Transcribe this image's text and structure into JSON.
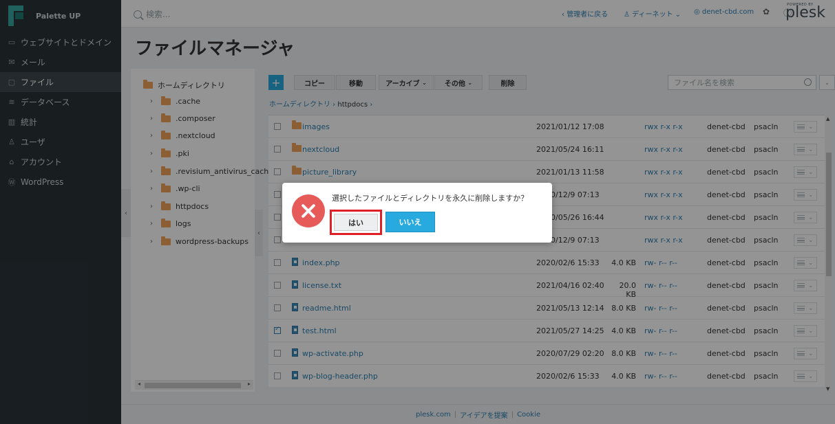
{
  "brand": {
    "name": "Palette UP"
  },
  "sidebar": {
    "items": [
      {
        "label": "ウェブサイトとドメイン",
        "icon": "monitor-icon",
        "active": false
      },
      {
        "label": "メール",
        "icon": "mail-icon",
        "active": false
      },
      {
        "label": "ファイル",
        "icon": "folder-icon",
        "active": true
      },
      {
        "label": "データベース",
        "icon": "database-icon",
        "active": false
      },
      {
        "label": "統計",
        "icon": "chart-icon",
        "active": false
      },
      {
        "label": "ユーザ",
        "icon": "user-icon",
        "active": false
      },
      {
        "label": "アカウント",
        "icon": "account-icon",
        "active": false
      },
      {
        "label": "WordPress",
        "icon": "wordpress-icon",
        "active": false
      }
    ]
  },
  "header": {
    "search_placeholder": "検索...",
    "back_admin": "管理者に戻る",
    "account": "ディーネット",
    "domain": "denet-cbd.com",
    "powered_by": "POWERED BY",
    "plesk": "plesk"
  },
  "page": {
    "title": "ファイルマネージャ"
  },
  "tree": {
    "root": "ホームディレクトリ",
    "items": [
      ".cache",
      ".composer",
      ".nextcloud",
      ".pki",
      ".revisium_antivirus_cach",
      ".wp-cli",
      "httpdocs",
      "logs",
      "wordpress-backups"
    ]
  },
  "toolbar": {
    "add": "+",
    "copy": "コピー",
    "move": "移動",
    "archive": "アーカイブ",
    "other": "その他",
    "delete": "削除",
    "search_placeholder": "ファイル名を検索"
  },
  "breadcrumb": {
    "root": "ホームディレクトリ",
    "current": "httpdocs"
  },
  "files": [
    {
      "name": "images",
      "type": "folder",
      "date": "2021/01/12 17:08",
      "size": "",
      "perm": "rwx r-x r-x",
      "user": "denet-cbd",
      "group": "psacln",
      "checked": false
    },
    {
      "name": "nextcloud",
      "type": "folder",
      "date": "2021/05/24 16:11",
      "size": "",
      "perm": "rwx r-x r-x",
      "user": "denet-cbd",
      "group": "psacln",
      "checked": false
    },
    {
      "name": "picture_library",
      "type": "folder",
      "date": "2021/01/13 11:58",
      "size": "",
      "perm": "rwx r-x r-x",
      "user": "denet-cbd",
      "group": "psacln",
      "checked": false
    },
    {
      "name": "",
      "type": "folder",
      "date": "2020/12/9 07:13",
      "size": "",
      "perm": "rwx r-x r-x",
      "user": "denet-cbd",
      "group": "psacln",
      "checked": false
    },
    {
      "name": "",
      "type": "folder",
      "date": "2020/05/26 16:44",
      "size": "",
      "perm": "rwx r-x r-x",
      "user": "denet-cbd",
      "group": "psacln",
      "checked": false
    },
    {
      "name": "",
      "type": "folder",
      "date": "2020/12/9 07:13",
      "size": "",
      "perm": "rwx r-x r-x",
      "user": "denet-cbd",
      "group": "psacln",
      "checked": false
    },
    {
      "name": "index.php",
      "type": "file",
      "date": "2020/02/6 15:33",
      "size": "4.0 KB",
      "perm": "rw- r-- r--",
      "user": "denet-cbd",
      "group": "psacln",
      "checked": false
    },
    {
      "name": "license.txt",
      "type": "file",
      "date": "2021/04/16 02:40",
      "size": "20.0 KB",
      "perm": "rw- r-- r--",
      "user": "denet-cbd",
      "group": "psacln",
      "checked": false
    },
    {
      "name": "readme.html",
      "type": "file",
      "date": "2021/05/13 12:14",
      "size": "8.0 KB",
      "perm": "rw- r-- r--",
      "user": "denet-cbd",
      "group": "psacln",
      "checked": false
    },
    {
      "name": "test.html",
      "type": "file",
      "date": "2021/05/27 14:25",
      "size": "4.0 KB",
      "perm": "rw- r-- r--",
      "user": "denet-cbd",
      "group": "psacln",
      "checked": true
    },
    {
      "name": "wp-activate.php",
      "type": "file",
      "date": "2020/07/29 02:20",
      "size": "8.0 KB",
      "perm": "rw- r-- r--",
      "user": "denet-cbd",
      "group": "psacln",
      "checked": false
    },
    {
      "name": "wp-blog-header.php",
      "type": "file",
      "date": "2020/02/6 15:33",
      "size": "4.0 KB",
      "perm": "rw- r-- r--",
      "user": "denet-cbd",
      "group": "psacln",
      "checked": false
    }
  ],
  "footer": {
    "link1": "plesk.com",
    "link2": "アイデアを提案",
    "link3": "Cookie"
  },
  "dialog": {
    "message": "選択したファイルとディレクトリを永久に削除しますか？",
    "yes": "はい",
    "no": "いいえ"
  },
  "colors": {
    "accent": "#28aade",
    "danger": "#e75a5a",
    "highlight": "#e01e26",
    "sidebar": "#2a3338"
  }
}
